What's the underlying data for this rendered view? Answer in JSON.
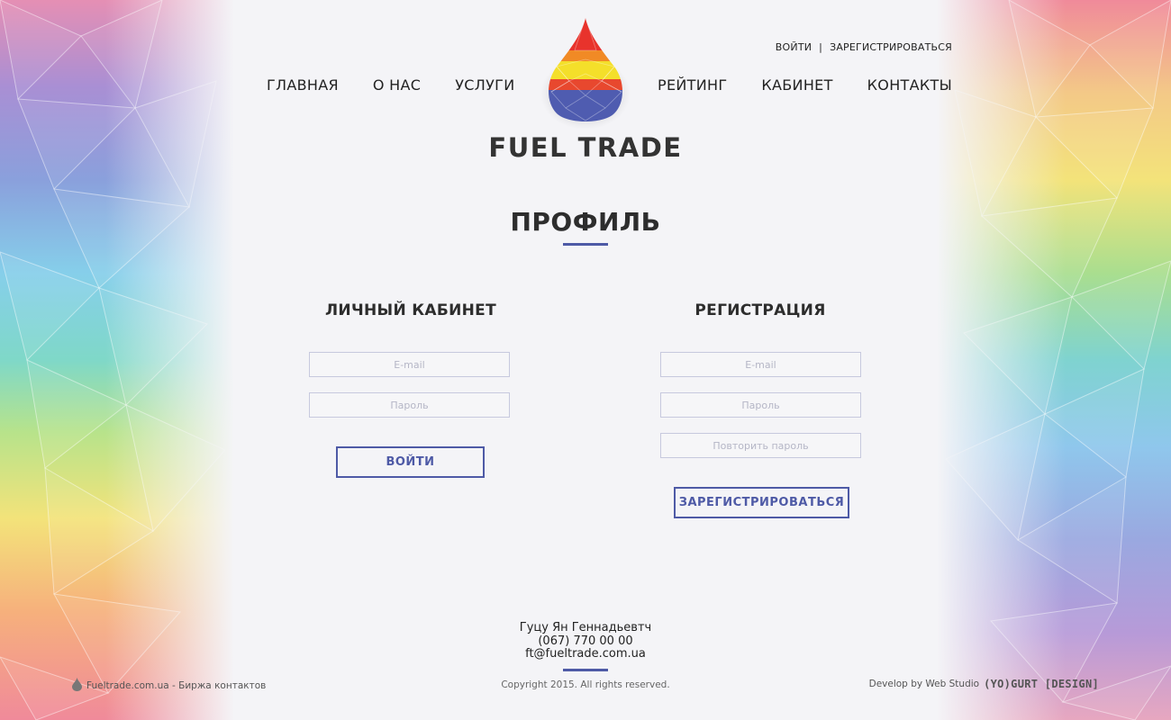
{
  "header": {
    "auth": {
      "login": "ВОЙТИ",
      "separator": "|",
      "register": "ЗАРЕГИСТРИРОВАТЬСЯ"
    },
    "nav_left": [
      "ГЛАВНАЯ",
      "О НАС",
      "УСЛУГИ"
    ],
    "nav_right": [
      "РЕЙТИНГ",
      "КАБИНЕТ",
      "КОНТАКТЫ"
    ],
    "logo_text": "FUEL TRADE"
  },
  "page": {
    "title": "ПРОФИЛЬ",
    "accent_color": "#4e5aa6"
  },
  "login": {
    "title": "ЛИЧНЫЙ КАБИНЕТ",
    "email_placeholder": "E-mail",
    "password_placeholder": "Пароль",
    "button": "ВОЙТИ"
  },
  "register": {
    "title": "РЕГИСТРАЦИЯ",
    "email_placeholder": "E-mail",
    "password_placeholder": "Пароль",
    "repeat_placeholder": "Повторить пароль",
    "button": "ЗАРЕГИСТРИРОВАТЬСЯ"
  },
  "footer": {
    "contact_name": "Гуцу Ян Геннадьевтч",
    "contact_phone": "(067) 770 00 00",
    "contact_email": "ft@fueltrade.com.ua",
    "left_text": "Fueltrade.com.ua - Биржа контактов",
    "copyright": "Copyright 2015. All rights reserved.",
    "developer_text": "Develop by Web Studio",
    "developer_logo": "(YO)GURT [DESIGN]",
    "icons": {
      "drop": "drop-icon"
    }
  }
}
